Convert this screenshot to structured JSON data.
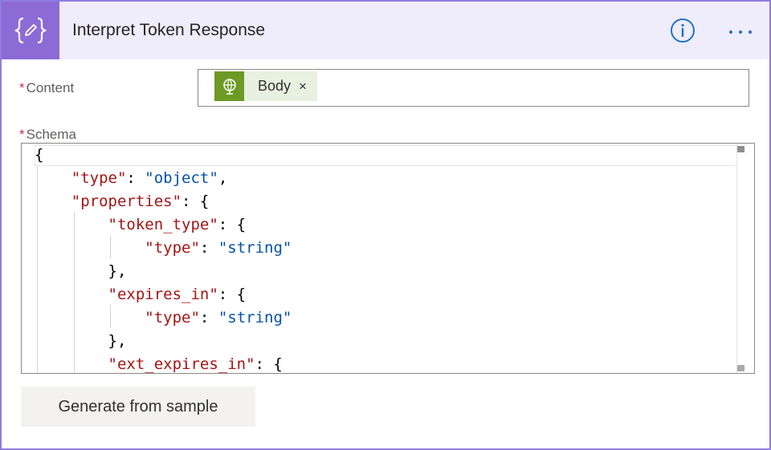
{
  "header": {
    "title": "Interpret Token Response",
    "icon": "code-braces-icon",
    "info_icon": "info-icon",
    "more_icon": "more-options-icon",
    "accent_color": "#8c6bd6"
  },
  "content_field": {
    "label": "Content",
    "required_marker": "*",
    "token": {
      "label": "Body",
      "close": "×",
      "icon": "globe-icon",
      "color": "#6c9a24"
    }
  },
  "schema_field": {
    "label": "Schema",
    "required_marker": "*",
    "lines": [
      {
        "p": [
          "{"
        ]
      },
      {
        "k": "\"type\"",
        "p": [
          ": "
        ],
        "s": "\"object\"",
        "tail": ","
      },
      {
        "k": "\"properties\"",
        "tail": ": {"
      },
      {
        "k": "\"token_type\"",
        "tail": ": {"
      },
      {
        "k": "\"type\"",
        "mid": ": ",
        "s": "\"string\""
      },
      {
        "p": [
          "},"
        ]
      },
      {
        "k": "\"expires_in\"",
        "tail": ": {"
      },
      {
        "k": "\"type\"",
        "mid": ": ",
        "s": "\"string\""
      },
      {
        "p": [
          "},"
        ]
      },
      {
        "k": "\"ext_expires_in\"",
        "tail": ": {"
      }
    ]
  },
  "generate_button": {
    "label": "Generate from sample"
  }
}
